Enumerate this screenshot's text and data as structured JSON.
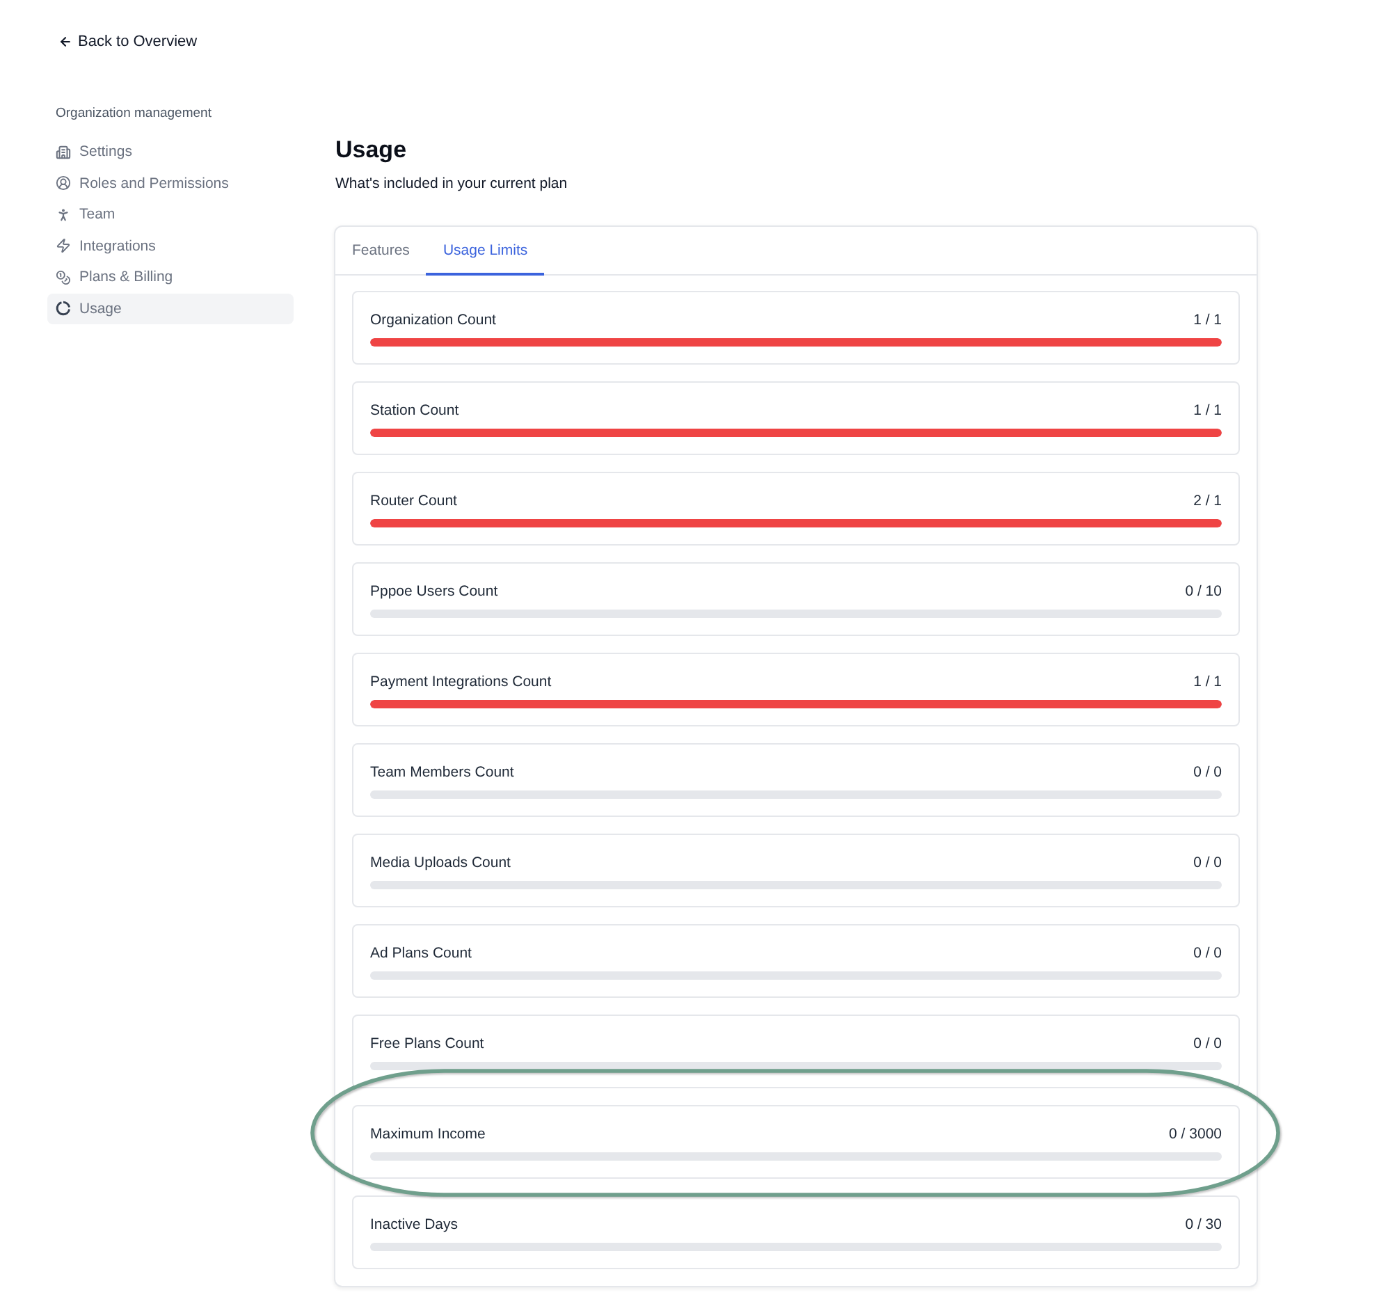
{
  "back_link": {
    "label": "Back to Overview"
  },
  "sidebar": {
    "heading": "Organization management",
    "items": [
      {
        "label": "Settings",
        "selected": false
      },
      {
        "label": "Roles and Permissions",
        "selected": false
      },
      {
        "label": "Team",
        "selected": false
      },
      {
        "label": "Integrations",
        "selected": false
      },
      {
        "label": "Plans & Billing",
        "selected": false
      },
      {
        "label": "Usage",
        "selected": true
      }
    ]
  },
  "page": {
    "title": "Usage",
    "subtitle": "What's included in your current plan"
  },
  "tabs": [
    {
      "label": "Features",
      "selected": false
    },
    {
      "label": "Usage Limits",
      "selected": true
    }
  ],
  "usage_limits": [
    {
      "name": "Organization Count",
      "reading": "1 / 1",
      "level": 1,
      "highlighted": false
    },
    {
      "name": "Station Count",
      "reading": "1 / 1",
      "level": 1,
      "highlighted": false
    },
    {
      "name": "Router Count",
      "reading": "2 / 1",
      "level": 1,
      "highlighted": false
    },
    {
      "name": "Pppoe Users Count",
      "reading": "0 / 10",
      "highlighted": false
    },
    {
      "name": "Payment Integrations Count",
      "reading": "1 / 1",
      "level": 1,
      "highlighted": false
    },
    {
      "name": "Team Members Count",
      "reading": "0 / 0",
      "highlighted": false
    },
    {
      "name": "Media Uploads Count",
      "reading": "0 / 0",
      "highlighted": false
    },
    {
      "name": "Ad Plans Count",
      "reading": "0 / 0",
      "highlighted": false
    },
    {
      "name": "Free Plans Count",
      "reading": "0 / 0",
      "highlighted": false
    },
    {
      "name": "Maximum Income",
      "reading": "0 / 3000",
      "highlighted": true
    },
    {
      "name": "Inactive Days",
      "reading": "0 / 30",
      "highlighted": false
    }
  ]
}
